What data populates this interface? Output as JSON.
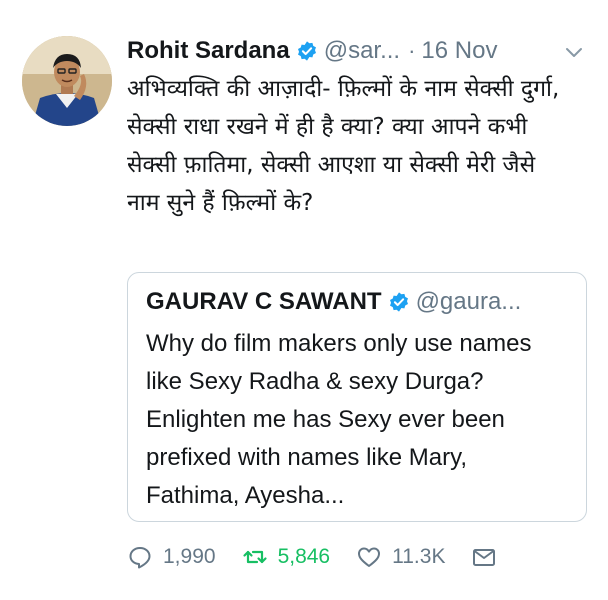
{
  "tweet": {
    "author_name": "Rohit Sardana",
    "handle": "@sar...",
    "separator": "·",
    "timestamp": "16 Nov",
    "text": "अभिव्यक्ति की आज़ादी- फ़िल्मों के नाम सेक्सी दुर्गा, सेक्सी राधा रखने में ही है क्या? क्या आपने कभी सेक्सी फ़ातिमा, सेक्सी आएशा या सेक्सी मेरी जैसे नाम सुने हैं फ़िल्मों के?"
  },
  "quoted_tweet": {
    "author_name": "GAURAV C SAWANT",
    "handle": "@gaura...",
    "text": "Why do film makers only use names like Sexy Radha & sexy Durga? Enlighten me has Sexy ever been prefixed with names like Mary, Fathima, Ayesha..."
  },
  "actions": {
    "replies": "1,990",
    "retweets": "5,846",
    "likes": "11.3K"
  },
  "icons": {
    "verified": "verified-badge-icon",
    "menu": "chevron-down-icon",
    "reply": "reply-icon",
    "retweet": "retweet-icon",
    "like": "heart-icon",
    "message": "envelope-icon"
  },
  "colors": {
    "verified_blue": "#1da1f2",
    "secondary_text": "#657786",
    "retweet_green": "#17bf63",
    "border": "#ccd6dd"
  }
}
